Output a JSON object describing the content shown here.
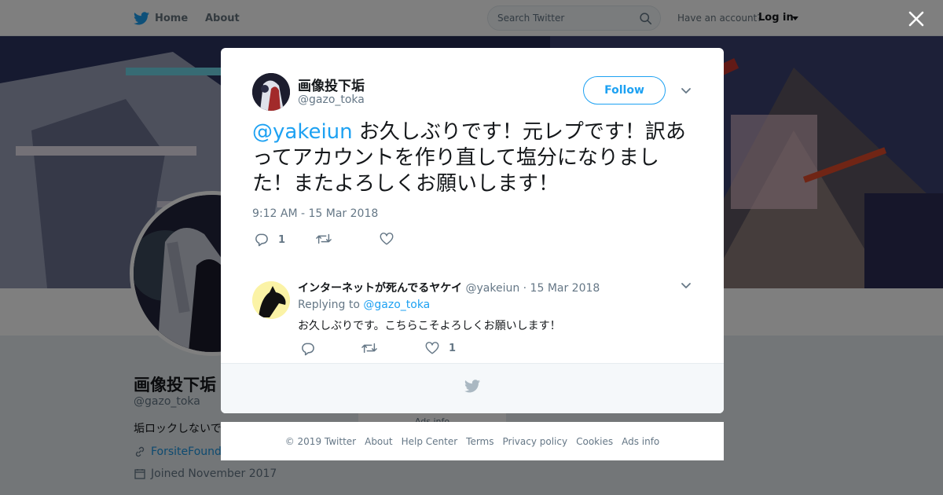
{
  "topbar": {
    "home_label": "Home",
    "about_label": "About",
    "search_placeholder": "Search Twitter",
    "account_question": "Have an account?",
    "login_label": "Log in"
  },
  "profile": {
    "name": "画像投下垢",
    "handle": "@gazo_toka",
    "bio": "垢ロックしないで",
    "link": "ForsiteFounda",
    "joined": "Joined November 2017"
  },
  "ads_info_behind": "Ads info",
  "tweet": {
    "author_name": "画像投下垢",
    "author_handle": "@gazo_toka",
    "follow_label": "Follow",
    "mention": "@yakeiun",
    "text": " お久しぶりです！元レプです！訳あってアカウントを作り直して塩分になりました！またよろしくお願いします！",
    "time": "9:12 AM - 15 Mar 2018",
    "reply_count": "1",
    "retweet_count": "",
    "like_count": ""
  },
  "reply": {
    "author_name": "インターネットが死んでるヤケイ",
    "meta": " @yakeiun · 15 Mar 2018",
    "replying_label": "Replying to",
    "replying_mention": "@gazo_toka",
    "text": "お久しぶりです。こちらこそよろしくお願いします！",
    "reply_count": "",
    "retweet_count": "",
    "like_count": "1"
  },
  "footer": {
    "items": [
      "© 2019 Twitter",
      "About",
      "Help Center",
      "Terms",
      "Privacy policy",
      "Cookies",
      "Ads info"
    ]
  },
  "colors": {
    "brand": "#1da1f2",
    "text": "#14171a",
    "muted": "#657786"
  },
  "icons": [
    "twitter-bird-icon",
    "search-icon",
    "close-icon",
    "chevron-down-icon",
    "reply-icon",
    "retweet-icon",
    "heart-icon",
    "link-icon",
    "calendar-icon"
  ]
}
